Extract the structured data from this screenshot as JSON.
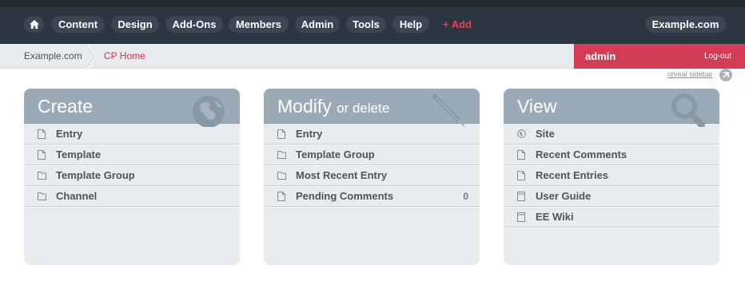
{
  "nav": {
    "home_icon": "home-icon",
    "items": [
      {
        "label": "Content"
      },
      {
        "label": "Design"
      },
      {
        "label": "Add-Ons"
      },
      {
        "label": "Members"
      },
      {
        "label": "Admin"
      },
      {
        "label": "Tools"
      },
      {
        "label": "Help"
      }
    ],
    "add_label": "+ Add",
    "site_label": "Example.com"
  },
  "breadcrumb": {
    "root": "Example.com",
    "current": "CP Home"
  },
  "user": {
    "name": "admin",
    "logout": "Log-out"
  },
  "reveal_sidebar": "reveal sidebar",
  "panels": {
    "create": {
      "title": "Create",
      "icon": "globe-icon",
      "items": [
        {
          "label": "Entry",
          "icon": "document-icon"
        },
        {
          "label": "Template",
          "icon": "document-icon"
        },
        {
          "label": "Template Group",
          "icon": "folder-icon"
        },
        {
          "label": "Channel",
          "icon": "folder-icon"
        }
      ]
    },
    "modify": {
      "title": "Modify",
      "subtitle": "or delete",
      "icon": "pencil-icon",
      "items": [
        {
          "label": "Entry",
          "icon": "document-icon",
          "count": ""
        },
        {
          "label": "Template Group",
          "icon": "folder-icon",
          "count": ""
        },
        {
          "label": "Most Recent Entry",
          "icon": "folder-icon",
          "count": ""
        },
        {
          "label": "Pending Comments",
          "icon": "document-icon",
          "count": "0"
        }
      ]
    },
    "view": {
      "title": "View",
      "icon": "magnifier-icon",
      "items": [
        {
          "label": "Site",
          "icon": "globe-small-icon"
        },
        {
          "label": "Recent Comments",
          "icon": "document-icon"
        },
        {
          "label": "Recent Entries",
          "icon": "document-icon"
        },
        {
          "label": "User Guide",
          "icon": "book-icon"
        },
        {
          "label": "EE Wiki",
          "icon": "book-icon"
        }
      ]
    }
  },
  "colors": {
    "nav_bg": "#2b3641",
    "accent_red": "#d23c54",
    "panel_head": "#9aabb7",
    "panel_body": "#e8ecef"
  }
}
